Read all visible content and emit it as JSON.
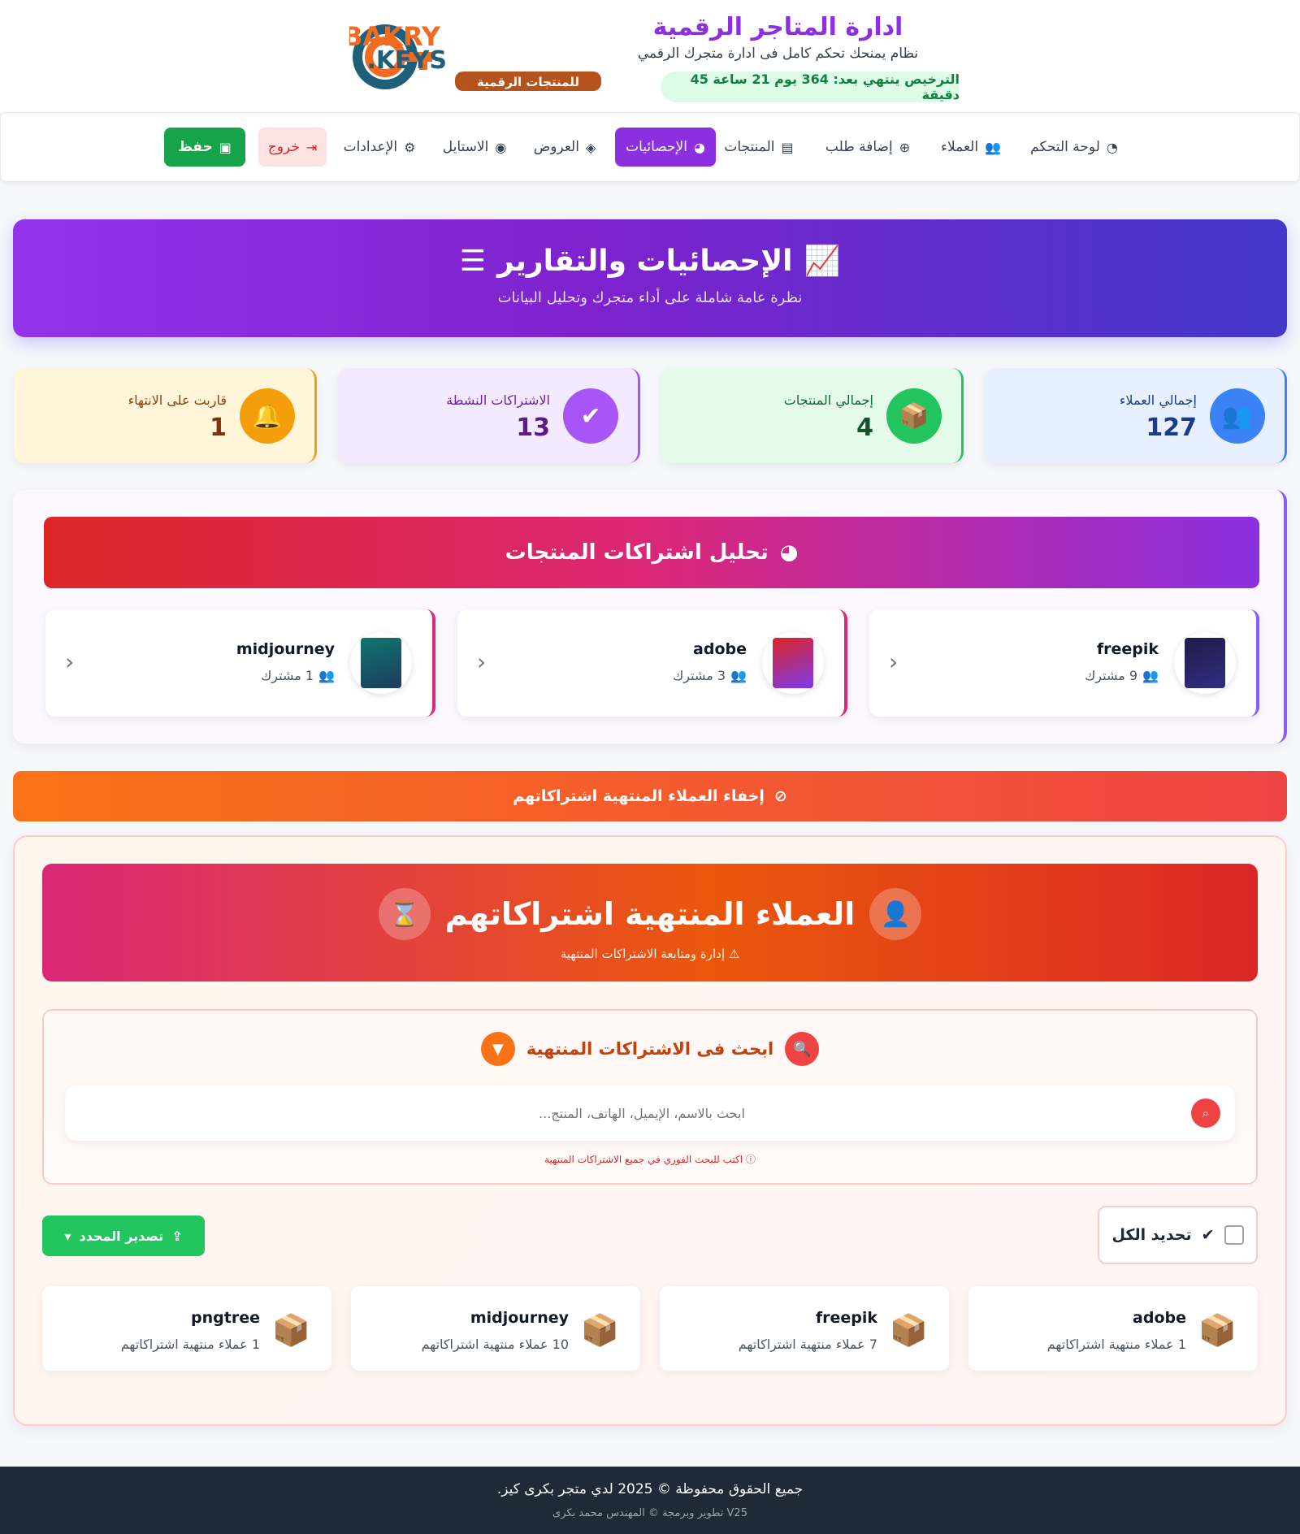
{
  "header": {
    "logo_line1": "BAKRY",
    "logo_line2": "KEYS.",
    "logo_tagline": "للمنتجات الرقمية",
    "title": "ادارة المتاجر الرقمية",
    "subtitle": "نظام يمنحك تحكم كامل فى ادارة متجرك الرقمي",
    "license": "الترخيص ينتهي بعد: 364 يوم 21 ساعة 45 دقيقة"
  },
  "nav": [
    {
      "label": "لوحة التحكم",
      "icon": "gauge-icon"
    },
    {
      "label": "العملاء",
      "icon": "users-icon"
    },
    {
      "label": "إضافة طلب",
      "icon": "plus-circle-icon"
    },
    {
      "label": "المنتجات",
      "icon": "boxes-icon"
    },
    {
      "label": "الإحصائيات",
      "icon": "chart-pie-icon",
      "active": true
    },
    {
      "label": "العروض",
      "icon": "tag-icon"
    },
    {
      "label": "الاستايل",
      "icon": "palette-icon"
    },
    {
      "label": "الإعدادات",
      "icon": "gear-icon"
    },
    {
      "label": "خروج",
      "icon": "logout-icon"
    },
    {
      "label": "حفظ",
      "icon": "save-icon"
    }
  ],
  "hero": {
    "title": "الإحصائيات والتقارير",
    "subtitle": "نظرة عامة شاملة على أداء متجرك وتحليل البيانات"
  },
  "stats": [
    {
      "label": "إجمالي العملاء",
      "value": "127",
      "icon": "users-icon",
      "color": "#3b82f6"
    },
    {
      "label": "إجمالي المنتجات",
      "value": "4",
      "icon": "box-open-icon",
      "color": "#22c55e"
    },
    {
      "label": "الاشتراكات النشطة",
      "value": "13",
      "icon": "check-circle-icon",
      "color": "#a855f7"
    },
    {
      "label": "قاربت على الانتهاء",
      "value": "1",
      "icon": "bell-icon",
      "color": "#f59e0b"
    }
  ],
  "analysis": {
    "title": "تحليل اشتراكات المنتجات",
    "products": [
      {
        "name": "freepik",
        "subs": "9 مشترك"
      },
      {
        "name": "adobe",
        "subs": "3 مشترك"
      },
      {
        "name": "midjourney",
        "subs": "1 مشترك"
      }
    ]
  },
  "toggle": {
    "label": "إخفاء العملاء المنتهية اشتراكاتهم"
  },
  "expired": {
    "title": "العملاء المنتهية اشتراكاتهم",
    "subtitle": "إدارة ومتابعة الاشتراكات المنتهية",
    "search_title": "ابحث فى الاشتراكات المنتهية",
    "search_placeholder": "ابحث بالاسم، الإيميل، الهاتف، المنتج...",
    "search_hint": "اكتب للبحث الفوري في جميع الاشتراكات المنتهية",
    "select_all": "تحديد الكل",
    "export": "تصدير المحدد",
    "products": [
      {
        "name": "adobe",
        "count": "1 عملاء منتهية اشتراكاتهم"
      },
      {
        "name": "freepik",
        "count": "7 عملاء منتهية اشتراكاتهم"
      },
      {
        "name": "midjourney",
        "count": "10 عملاء منتهية اشتراكاتهم"
      },
      {
        "name": "pngtree",
        "count": "1 عملاء منتهية اشتراكاتهم"
      }
    ]
  },
  "footer": {
    "line1": "جميع الحقوق محفوظة © 2025 لدي متجر بكرى كيز.",
    "line2": "V25 تطوير وبرمجة © المهندس محمد بكرى"
  }
}
